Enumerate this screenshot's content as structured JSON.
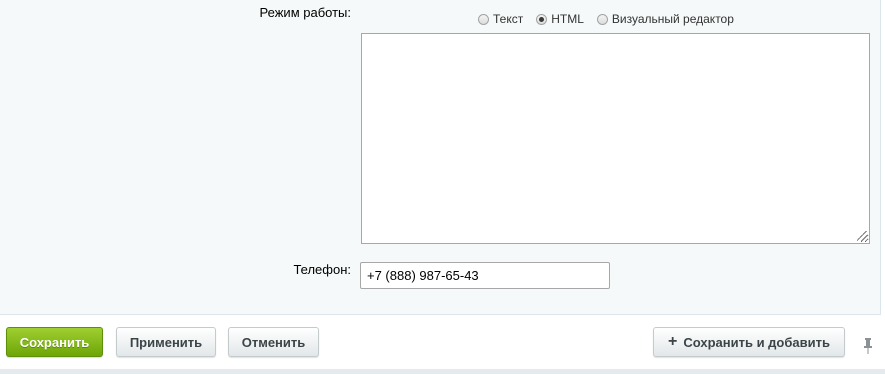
{
  "form": {
    "mode_label": "Режим работы:",
    "mode_options": [
      {
        "label": "Текст",
        "checked": false
      },
      {
        "label": "HTML",
        "checked": true
      },
      {
        "label": "Визуальный редактор",
        "checked": false
      }
    ],
    "editor_value": "",
    "phone_label": "Телефон:",
    "phone_value": "+7 (888) 987-65-43"
  },
  "buttons": {
    "save": "Сохранить",
    "apply": "Применить",
    "cancel": "Отменить",
    "save_add": "Сохранить и добавить"
  },
  "icons": {
    "plus": "plus-icon",
    "pin": "pin-icon"
  },
  "colors": {
    "save_button": "#7cb712",
    "form_background": "#f5f9f9"
  }
}
